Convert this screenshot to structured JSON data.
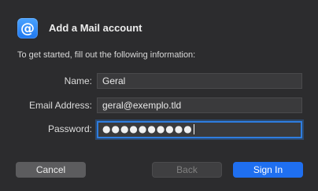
{
  "dialog": {
    "title": "Add a Mail account",
    "intro": "To get started, fill out the following information:",
    "app_icon_glyph": "@"
  },
  "form": {
    "name_label": "Name:",
    "name_value": "Geral",
    "email_label": "Email Address:",
    "email_value": "geral@exemplo.tld",
    "password_label": "Password:",
    "password_mask": "●●●●●●●●●●"
  },
  "buttons": {
    "cancel": "Cancel",
    "back": "Back",
    "sign_in": "Sign In"
  },
  "colors": {
    "accent": "#1f6ff0",
    "background": "#2c2c2e"
  },
  "icons": {
    "app_icon": "mail-at-icon"
  }
}
